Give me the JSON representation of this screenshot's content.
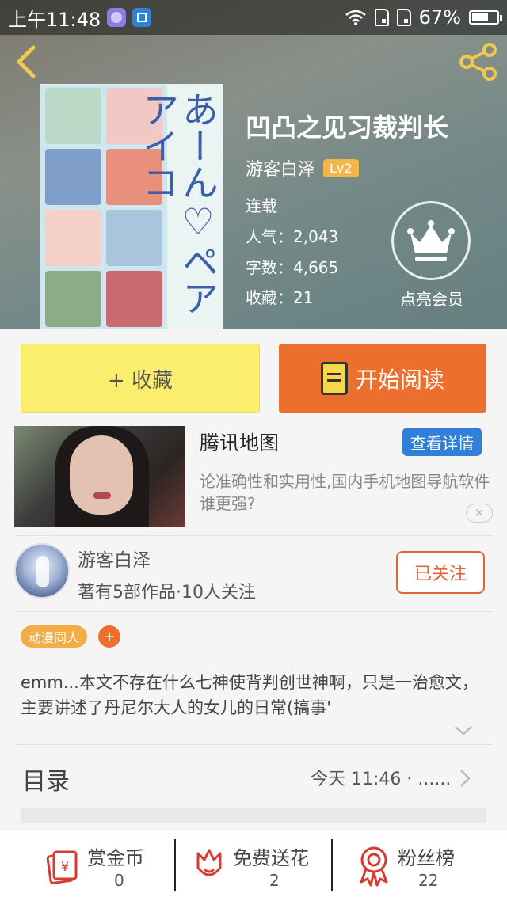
{
  "status_bar": {
    "time": "上午11:48",
    "battery": "67%",
    "battery_level": 0.67
  },
  "book": {
    "title": "凹凸之见习裁判长",
    "author": "游客白泽",
    "level": "Lv2",
    "status": "连载",
    "popularity_label": "人气：",
    "popularity": "2,043",
    "words_label": "字数：",
    "words": "4,665",
    "favorites_label": "收藏：",
    "favorites": "21",
    "cover_title": "あーん♡ペアアイコ",
    "vip_label": "点亮会员"
  },
  "actions": {
    "favorite": "+ 收藏",
    "read": "开始阅读"
  },
  "ad": {
    "title": "腾讯地图",
    "button": "查看详情",
    "description": "论准确性和实用性,国内手机地图导航软件谁更强?"
  },
  "author_panel": {
    "name": "游客白泽",
    "stats": "著有5部作品·10人关注",
    "follow_label": "已关注"
  },
  "tags": [
    "动漫同人"
  ],
  "intro": "emm...本文不存在什么七神使背判创世神啊，只是一治愈文，主要讲述了丹尼尔大人的女儿的日常(搞事'",
  "catalog": {
    "label": "目录",
    "update": "今天 11:46 · ......"
  },
  "bottom_bar": [
    {
      "label": "赏金币",
      "count": "0",
      "icon": "red-envelope-icon"
    },
    {
      "label": "免费送花",
      "count": "2",
      "icon": "flower-icon"
    },
    {
      "label": "粉丝榜",
      "count": "22",
      "icon": "ribbon-badge-icon"
    }
  ],
  "colors": {
    "accent": "#ed6f2e",
    "favorite_bg": "#fbee6f",
    "tag": "#f2ad45",
    "ad_button": "#2f80d6"
  }
}
